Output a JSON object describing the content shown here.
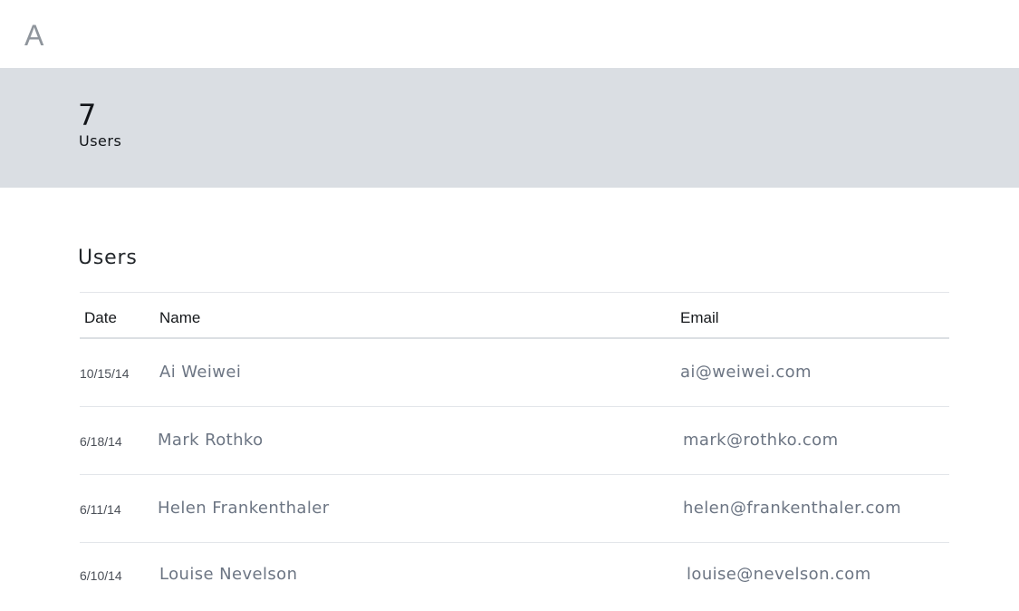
{
  "app": {
    "logo_text": "A"
  },
  "stats": {
    "user_count": "7",
    "user_count_label": "Users"
  },
  "users_section": {
    "title": "Users",
    "columns": {
      "date": "Date",
      "name": "Name",
      "email": "Email"
    },
    "rows": [
      {
        "date": "10/15/14",
        "name": "Ai Weiwei",
        "email": "ai@weiwei.com"
      },
      {
        "date": "6/18/14",
        "name": "Mark Rothko",
        "email": "mark@rothko.com"
      },
      {
        "date": "6/11/14",
        "name": "Helen Frankenthaler",
        "email": "helen@frankenthaler.com"
      },
      {
        "date": "6/10/14",
        "name": "Louise Nevelson",
        "email": "louise@nevelson.com"
      }
    ]
  }
}
